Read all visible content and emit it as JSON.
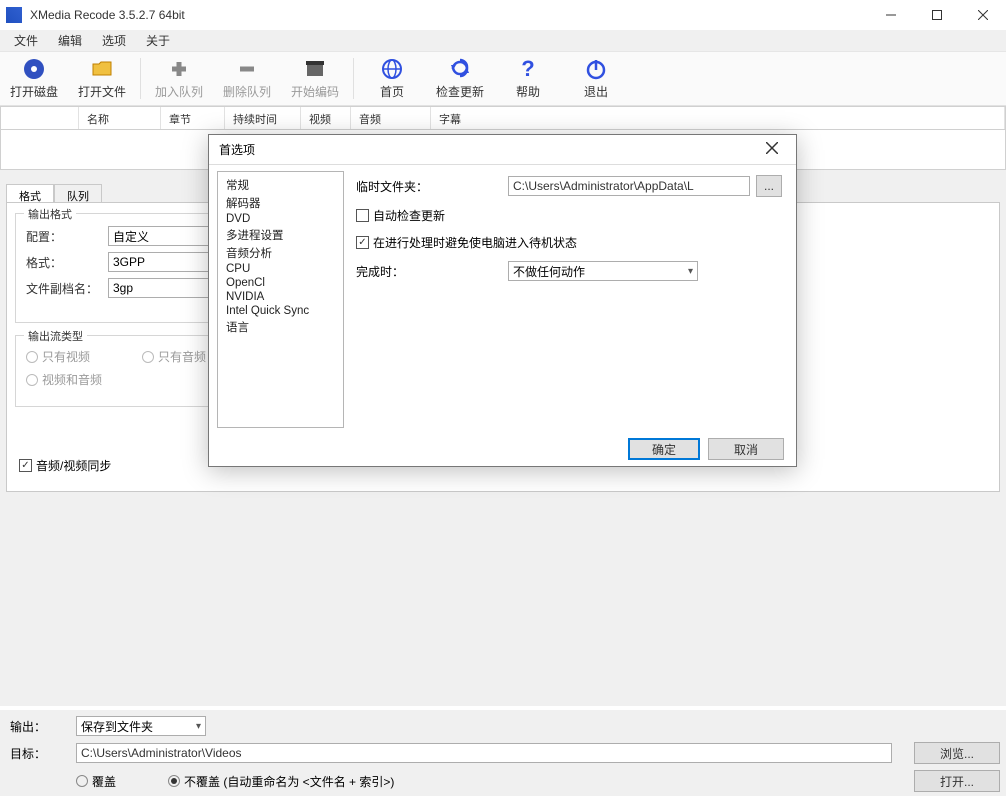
{
  "window": {
    "title": "XMedia Recode 3.5.2.7 64bit"
  },
  "menu": {
    "items": [
      "文件",
      "编辑",
      "选项",
      "关于"
    ]
  },
  "toolbar": {
    "open_disc": "打开磁盘",
    "open_file": "打开文件",
    "add_queue": "加入队列",
    "remove_queue": "删除队列",
    "start_encode": "开始编码",
    "homepage": "首页",
    "check_update": "检查更新",
    "help": "帮助",
    "exit": "退出"
  },
  "list_columns": [
    "",
    "名称",
    "章节",
    "持续时间",
    "视频",
    "音频",
    "字幕"
  ],
  "tabs": {
    "format": "格式",
    "queue": "队列"
  },
  "format_panel": {
    "group_output": "输出格式",
    "profile_label": "配置：",
    "profile_value": "自定义",
    "format_label": "格式：",
    "format_value": "3GPP",
    "ext_label": "文件副档名：",
    "ext_value": "3gp",
    "group_stream": "输出流类型",
    "only_video": "只有视频",
    "only_audio": "只有音频",
    "video_audio": "视频和音频",
    "av_sync": "音频/视频同步"
  },
  "output": {
    "out_label": "输出：",
    "out_value": "保存到文件夹",
    "target_label": "目标：",
    "target_value": "C:\\Users\\Administrator\\Videos",
    "overwrite": "覆盖",
    "no_overwrite": "不覆盖 (自动重命名为 <文件名 + 索引>)",
    "browse": "浏览...",
    "open": "打开..."
  },
  "dialog": {
    "title": "首选项",
    "list": [
      "常规",
      "解码器",
      "DVD",
      "多进程设置",
      "音频分析",
      "CPU",
      "OpenCl",
      "NVIDIA",
      "Intel Quick Sync",
      "语言"
    ],
    "temp_label": "临时文件夹：",
    "temp_value": "C:\\Users\\Administrator\\AppData\\L",
    "browse_btn": "...",
    "auto_check": "自动检查更新",
    "prevent_sleep": "在进行处理时避免使电脑进入待机状态",
    "on_complete_label": "完成时：",
    "on_complete_value": "不做任何动作",
    "ok": "确定",
    "cancel": "取消"
  }
}
